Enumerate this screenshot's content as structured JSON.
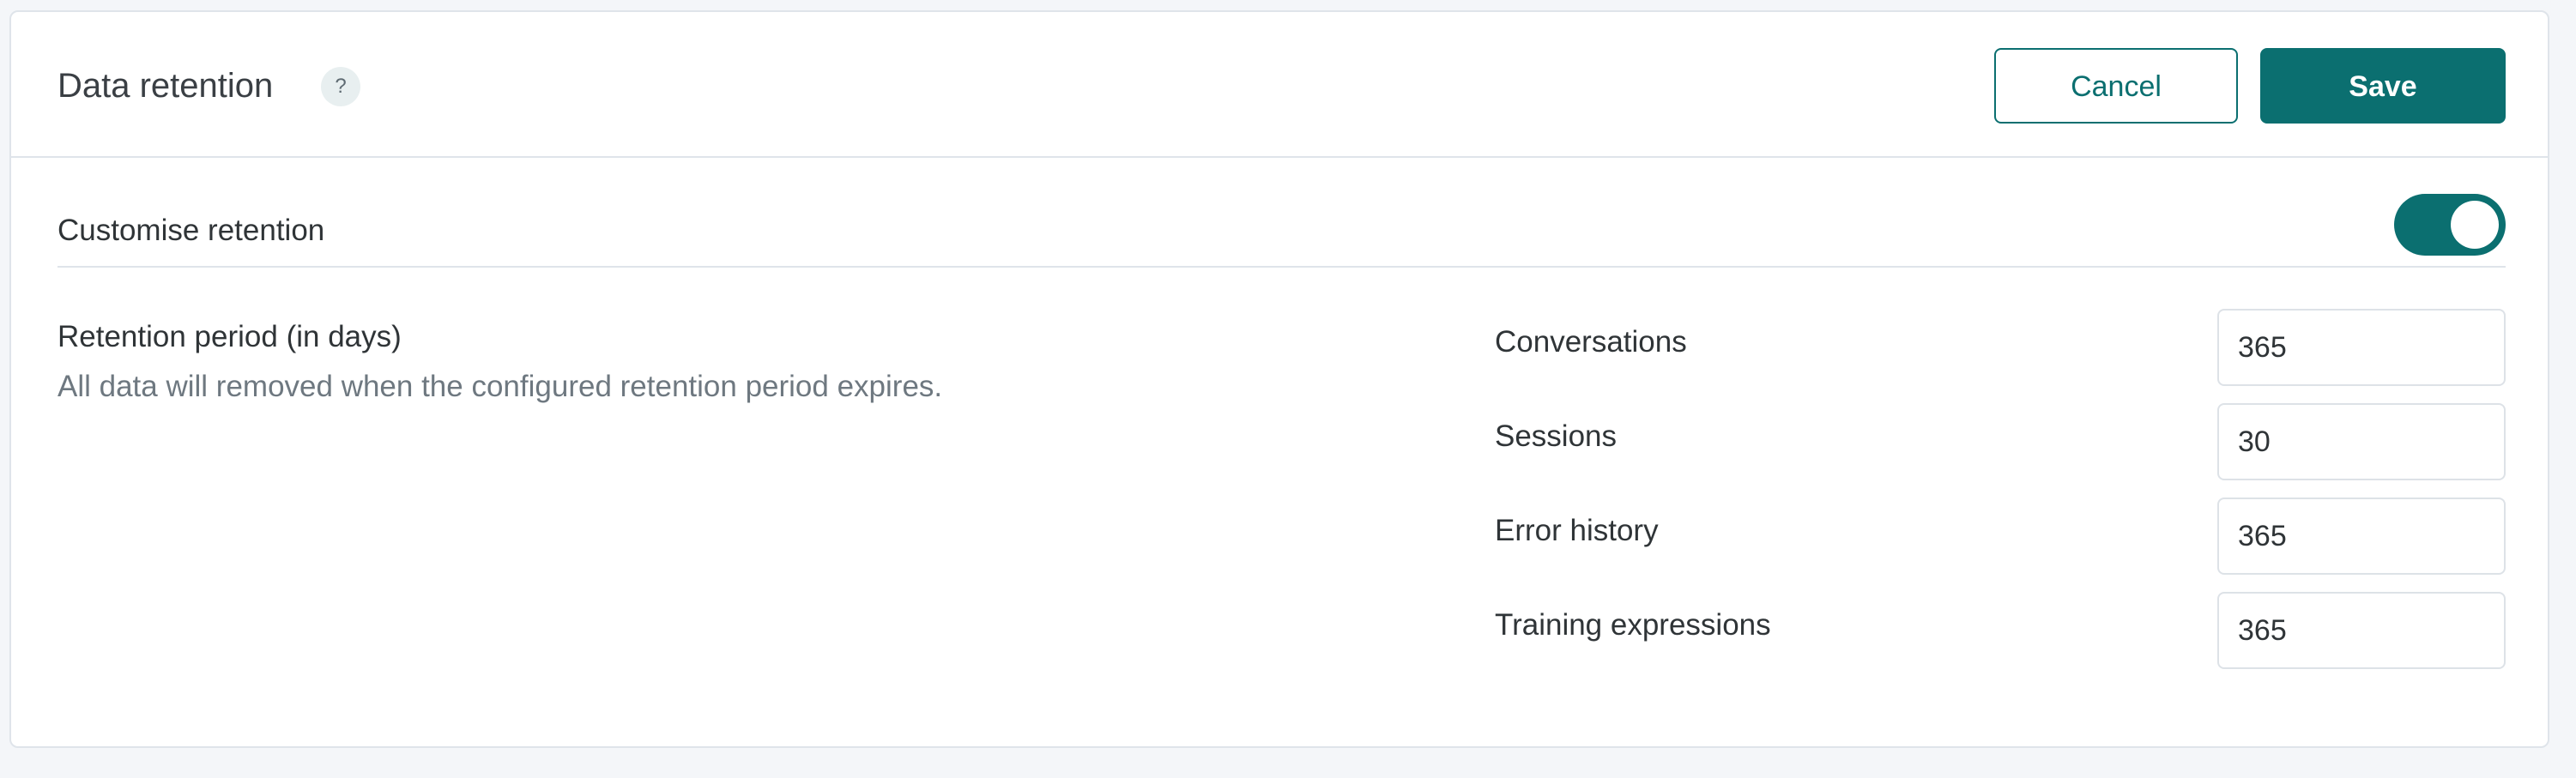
{
  "header": {
    "title": "Data retention",
    "help_icon_glyph": "?",
    "cancel_label": "Cancel",
    "save_label": "Save"
  },
  "customise": {
    "label": "Customise retention",
    "enabled": true
  },
  "retention": {
    "title": "Retention period (in days)",
    "description": "All data will removed when the configured retention period expires.",
    "fields": [
      {
        "label": "Conversations",
        "value": "365"
      },
      {
        "label": "Sessions",
        "value": "30"
      },
      {
        "label": "Error history",
        "value": "365"
      },
      {
        "label": "Training expressions",
        "value": "365"
      }
    ]
  },
  "colors": {
    "accent": "#0b6f70",
    "background": "#f4f6f9",
    "border": "#dfe4ea"
  }
}
